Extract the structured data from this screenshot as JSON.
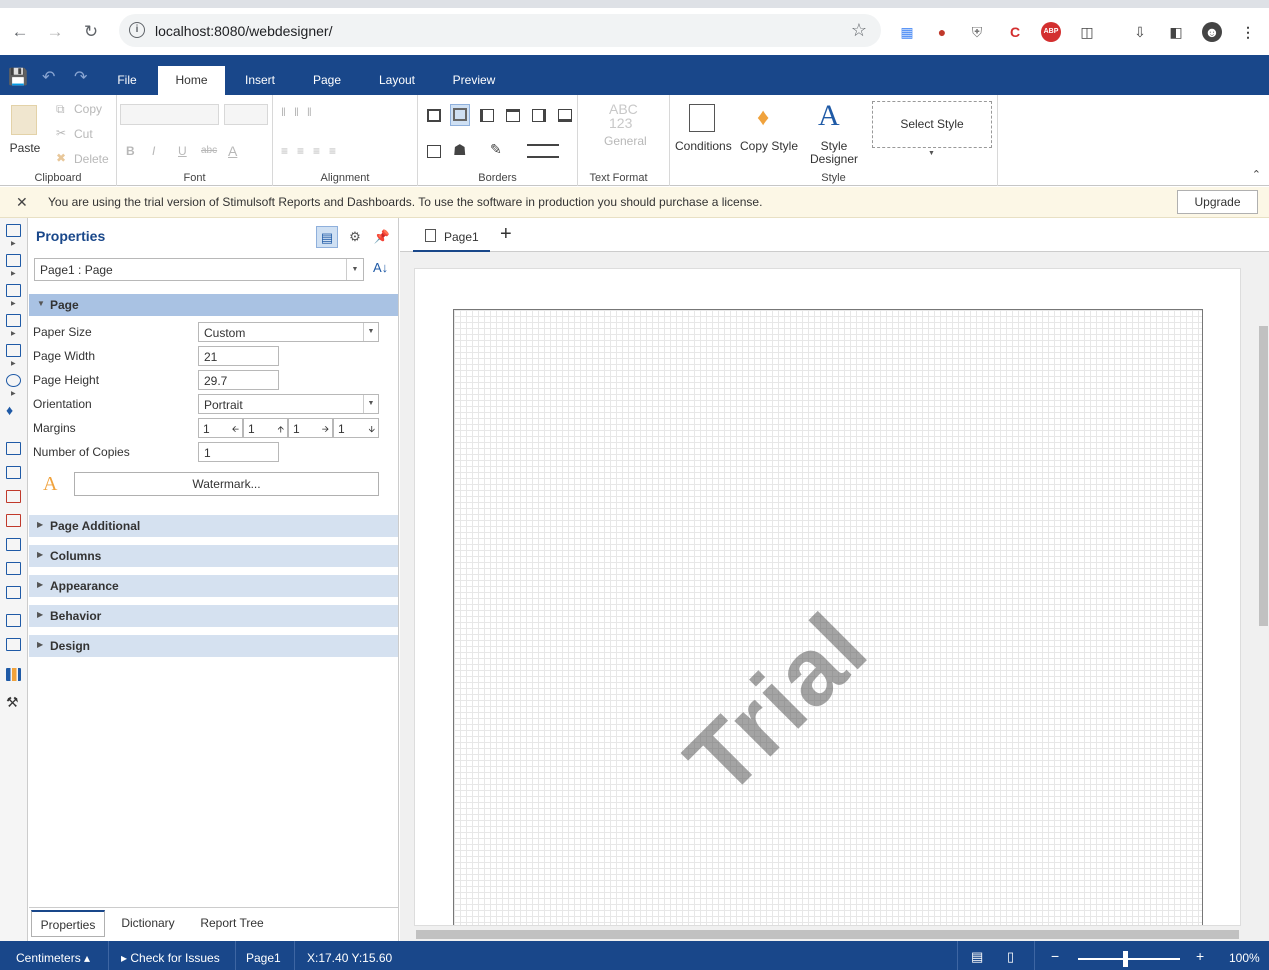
{
  "browser": {
    "url": "localhost:8080/webdesigner/"
  },
  "ribbon": {
    "tabs": [
      "File",
      "Home",
      "Insert",
      "Page",
      "Layout",
      "Preview"
    ],
    "active_tab": "Home",
    "clipboard": {
      "paste": "Paste",
      "copy": "Copy",
      "cut": "Cut",
      "delete": "Delete",
      "label": "Clipboard"
    },
    "font": {
      "label": "Font",
      "bold": "B",
      "italic": "I",
      "underline": "U",
      "strike": "abc",
      "color": "A"
    },
    "alignment": {
      "label": "Alignment"
    },
    "borders": {
      "label": "Borders"
    },
    "text_format": {
      "abc": "ABC",
      "num": "123",
      "general": "General",
      "label": "Text Format"
    },
    "style": {
      "conditions": "Conditions",
      "copy_style": "Copy Style",
      "style_designer_1": "Style",
      "style_designer_2": "Designer",
      "select_style": "Select Style",
      "label": "Style"
    }
  },
  "trial": {
    "message": "You are using the trial version of Stimulsoft Reports and Dashboards. To use the software in production you should purchase a license.",
    "upgrade": "Upgrade"
  },
  "properties": {
    "title": "Properties",
    "object": "Page1 : Page",
    "sections": {
      "page": "Page",
      "page_additional": "Page Additional",
      "columns": "Columns",
      "appearance": "Appearance",
      "behavior": "Behavior",
      "design": "Design"
    },
    "rows": {
      "paper_size_label": "Paper Size",
      "paper_size": "Custom",
      "page_width_label": "Page Width",
      "page_width": "21",
      "page_height_label": "Page Height",
      "page_height": "29.7",
      "orientation_label": "Orientation",
      "orientation": "Portrait",
      "margins_label": "Margins",
      "margin_left": "1",
      "margin_top": "1",
      "margin_right": "1",
      "margin_bottom": "1",
      "copies_label": "Number of Copies",
      "copies": "1"
    },
    "watermark": "Watermark...",
    "bottom_tabs": [
      "Properties",
      "Dictionary",
      "Report Tree"
    ]
  },
  "designer": {
    "page_tab": "Page1",
    "watermark_text": "Trial"
  },
  "status": {
    "units": "Centimeters",
    "check": "Check for Issues",
    "page": "Page1",
    "coords": "X:17.40 Y:15.60",
    "zoom": "100%"
  }
}
